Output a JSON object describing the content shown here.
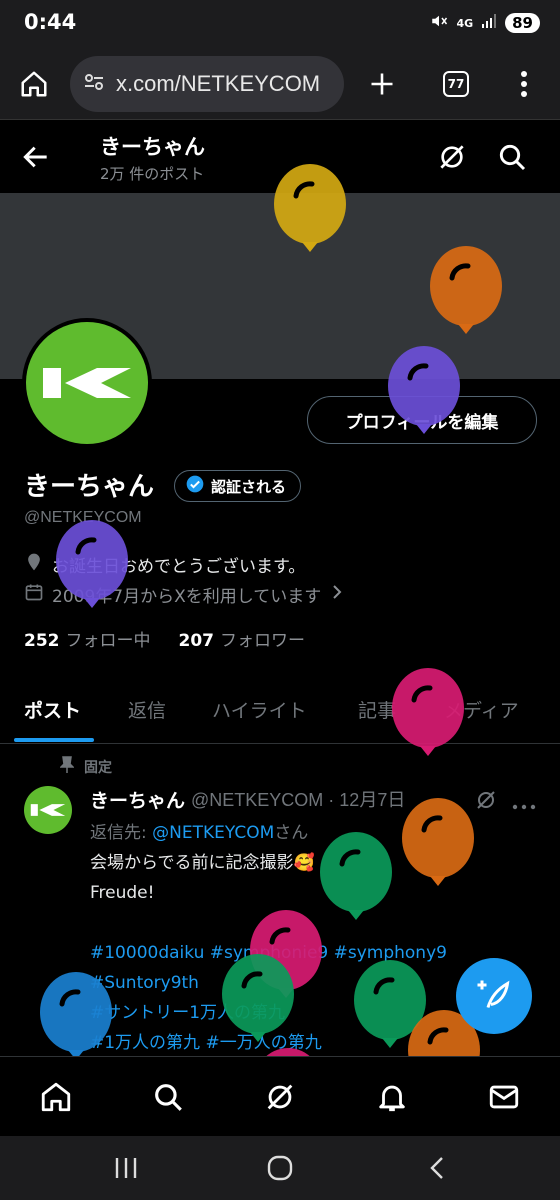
{
  "status": {
    "time": "0:44",
    "network": "4G",
    "battery": "89"
  },
  "browser": {
    "url": "x.com/NETKEYCOM",
    "tab_count": "77"
  },
  "profile": {
    "header_name": "きーちゃん",
    "post_count": "2万 件のポスト",
    "edit_label": "プロフィールを編集",
    "name": "きーちゃん",
    "verify_label": "認証される",
    "handle": "@NETKEYCOM",
    "bio": "お誕生日おめでとうございます。",
    "joined": "2009年7月からXを利用しています",
    "following_count": "252",
    "following_label": "フォロー中",
    "followers_count": "207",
    "followers_label": "フォロワー"
  },
  "tabs": [
    "ポスト",
    "返信",
    "ハイライト",
    "記事",
    "メディア"
  ],
  "tweet": {
    "pinned_label": "固定",
    "name": "きーちゃん",
    "meta": "@NETKEYCOM · 12月7日",
    "reply_prefix": "返信先: ",
    "reply_handle": "@NETKEYCOM",
    "reply_suffix": "さん",
    "line1": "会場からでる前に記念撮影🥰",
    "line2": "Freude!",
    "hashtags1": "#10000daiku #symphonie9 #symphony9",
    "hashtags2": "#Suntory9th",
    "hashtags3": "#サントリー1万人の第九",
    "hashtags4": "#1万人の第九 #一万人の第九"
  },
  "colors": {
    "accent": "#1d9bf0",
    "avatar_bg": "#5fbb2e",
    "balloons": [
      "#d4a912",
      "#d96a14",
      "#6b4fd8",
      "#6b4fd8",
      "#d81b72",
      "#d96a14",
      "#0b9a5a",
      "#d81b72",
      "#0b9a5a",
      "#0b9a5a",
      "#1a80d0",
      "#d96a14",
      "#d81b72"
    ]
  },
  "icons": [
    "back-arrow-icon",
    "grok-icon",
    "search-icon",
    "home-icon",
    "bell-icon",
    "mail-icon",
    "compose-icon",
    "pin-icon",
    "calendar-icon",
    "location-icon",
    "verified-icon"
  ]
}
